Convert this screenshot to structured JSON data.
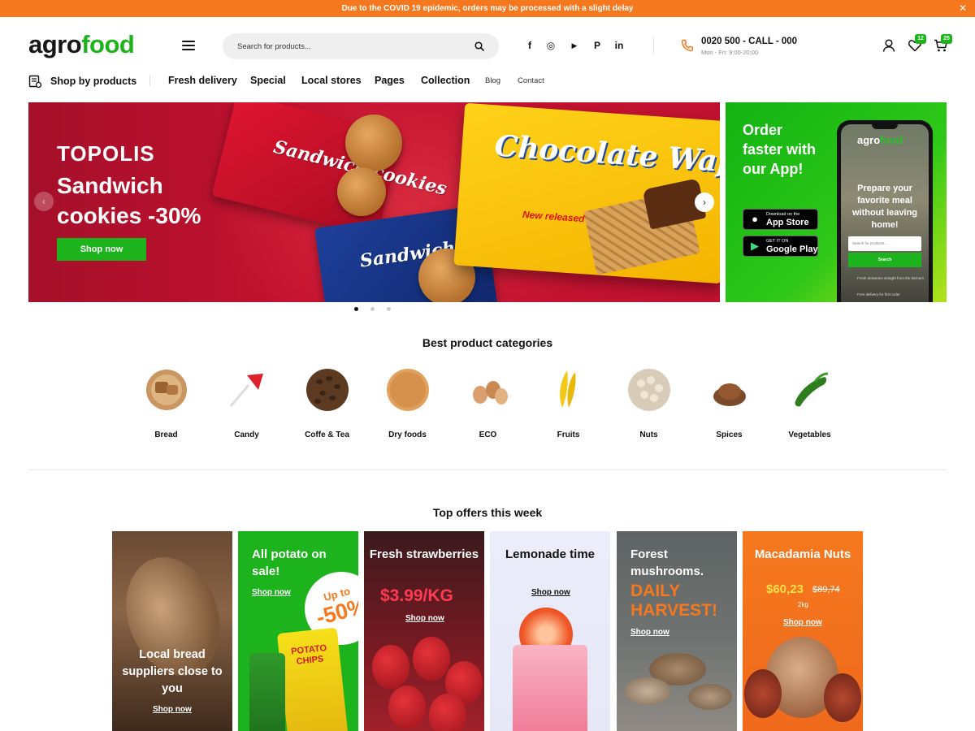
{
  "notice": {
    "text": "Due to the COVID 19 epidemic, orders may be processed with a slight delay",
    "close": "✕"
  },
  "header": {
    "logo_left": "agro",
    "logo_right": "food",
    "search_placeholder": "Search for products...",
    "social": [
      "f",
      "◎",
      "▶",
      "P",
      "in"
    ],
    "phone": "0020 500 - CALL - 000",
    "hours": "Mon - Fri: 9:00-20:00",
    "wishlist_count": "12",
    "cart_count": "25"
  },
  "nav": {
    "shop_by": "Shop by products",
    "items": [
      "Fresh delivery",
      "Special",
      "Local stores",
      "Pages",
      "Collection"
    ],
    "small_items": [
      "Blog",
      "Contact"
    ]
  },
  "hero": {
    "brand": "TOPOLIS",
    "headline": "Sandwich cookies -30%",
    "button": "Shop now",
    "pack1": "Sandwich cookies",
    "pack2": "Sandwich cookies",
    "pack3": "Chocolate Wafer",
    "pack3_sub": "New released",
    "prev": "‹",
    "next": "›"
  },
  "app_promo": {
    "title": "Order faster with our App!",
    "appstore_small": "Download on the",
    "appstore_big": "App Store",
    "googleplay_small": "GET IT ON",
    "googleplay_big": "Google Play",
    "phone_logo_left": "agro",
    "phone_logo_right": "food",
    "phone_text": "Prepare your favorite meal without leaving home!",
    "phone_search": "Search for products...",
    "phone_button": "Search",
    "phone_feature1": "Fresh deliveries straight from the farmers",
    "phone_feature2": "Free delivery for first order"
  },
  "categories": {
    "title": "Best product categories",
    "items": [
      {
        "name": "Bread",
        "icon": "bread-icon"
      },
      {
        "name": "Candy",
        "icon": "candy-icon"
      },
      {
        "name": "Coffe & Tea",
        "icon": "coffee-icon"
      },
      {
        "name": "Dry foods",
        "icon": "dry-foods-icon"
      },
      {
        "name": "ECO",
        "icon": "eggs-icon"
      },
      {
        "name": "Fruits",
        "icon": "bananas-icon"
      },
      {
        "name": "Nuts",
        "icon": "nuts-icon"
      },
      {
        "name": "Spices",
        "icon": "spices-icon"
      },
      {
        "name": "Vegetables",
        "icon": "cucumber-icon"
      }
    ]
  },
  "offers": {
    "title": "Top offers this week",
    "items": [
      {
        "title": "Local bread suppliers close to you",
        "link": "Shop now"
      },
      {
        "title": "All potato on sale!",
        "link": "Shop now",
        "badge_top": "Up to",
        "badge_big": "-50%",
        "chips": "POTATO CHIPS"
      },
      {
        "title": "Fresh strawberries",
        "price": "$3.99/KG",
        "link": "Shop now"
      },
      {
        "title": "Lemonade time",
        "link": "Shop now"
      },
      {
        "title": "Forest mushrooms.",
        "highlight": "DAILY HARVEST!",
        "link": "Shop now"
      },
      {
        "title": "Macadamia Nuts",
        "price": "$60,23",
        "old_price": "$89,74",
        "weight": "2kg",
        "link": "Shop now"
      }
    ]
  },
  "colors": {
    "accent_green": "#1cb31c",
    "notice_orange": "#f5781e",
    "hero_red": "#c4112f"
  }
}
